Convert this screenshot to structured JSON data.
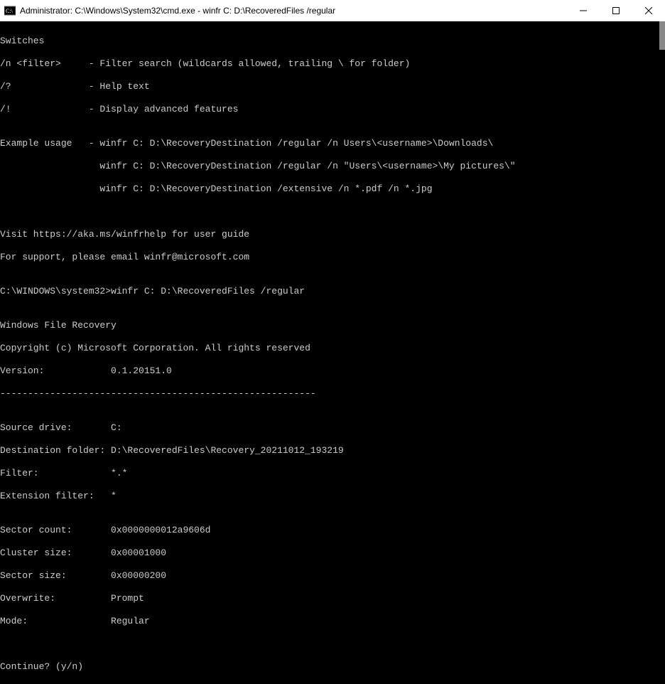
{
  "titlebar": {
    "title": "Administrator: C:\\Windows\\System32\\cmd.exe - winfr  C: D:\\RecoveredFiles /regular"
  },
  "terminal": {
    "lines": {
      "l0": "Switches",
      "l1": "/n <filter>     - Filter search (wildcards allowed, trailing \\ for folder)",
      "l2": "/?              - Help text",
      "l3": "/!              - Display advanced features",
      "l4": "",
      "l5": "Example usage   - winfr C: D:\\RecoveryDestination /regular /n Users\\<username>\\Downloads\\",
      "l6": "                  winfr C: D:\\RecoveryDestination /regular /n \"Users\\<username>\\My pictures\\\"",
      "l7": "                  winfr C: D:\\RecoveryDestination /extensive /n *.pdf /n *.jpg",
      "l8": "",
      "l9": "",
      "l10": "Visit https://aka.ms/winfrhelp for user guide",
      "l11": "For support, please email winfr@microsoft.com",
      "l12": "",
      "l13": "C:\\WINDOWS\\system32>winfr C: D:\\RecoveredFiles /regular",
      "l14": "",
      "l15": "Windows File Recovery",
      "l16": "Copyright (c) Microsoft Corporation. All rights reserved",
      "l17": "Version:            0.1.20151.0",
      "l18": "---------------------------------------------------------",
      "l19": "",
      "l20": "Source drive:       C:",
      "l21": "Destination folder: D:\\RecoveredFiles\\Recovery_20211012_193219",
      "l22": "Filter:             *.*",
      "l23": "Extension filter:   *",
      "l24": "",
      "l25": "Sector count:       0x0000000012a9606d",
      "l26": "Cluster size:       0x00001000",
      "l27": "Sector size:        0x00000200",
      "l28": "Overwrite:          Prompt",
      "l29": "Mode:               Regular",
      "l30": "",
      "l31": "",
      "l32": "Continue? (y/n)"
    }
  }
}
